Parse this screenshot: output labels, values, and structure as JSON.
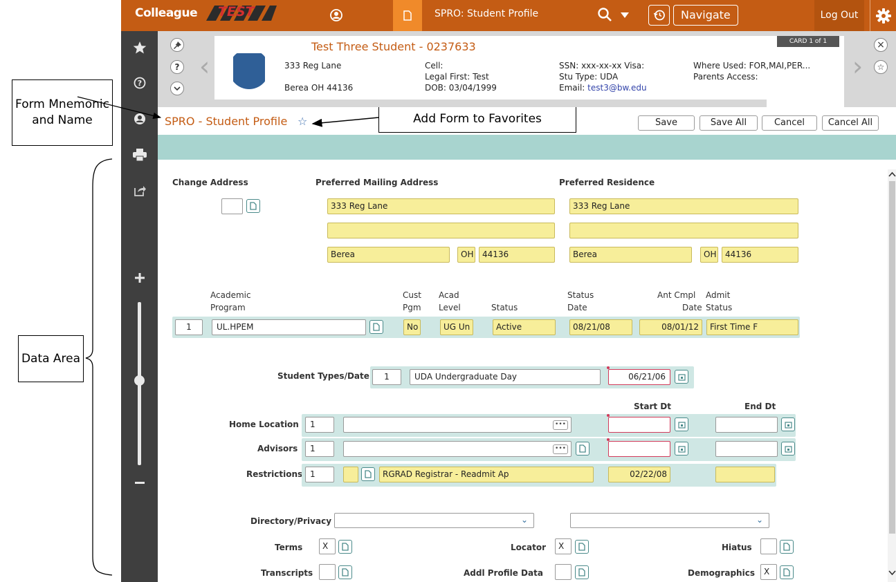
{
  "callouts": {
    "form_label": "Form Mnemonic and Name",
    "favorites_label": "Add Form to Favorites",
    "data_area_label": "Data Area"
  },
  "topbar": {
    "brand": "Colleague",
    "env": "TEST",
    "form_tab": "SPRO: Student Profile",
    "navigate": "Navigate",
    "logout": "Log Out"
  },
  "card": {
    "count": "CARD 1 of 1",
    "name": "Test Three Student  -  0237633",
    "addr1": "333 Reg Lane",
    "addr2": "Berea OH 44136",
    "cell": "Cell:",
    "legal_first": "Legal First: Test",
    "dob": "DOB: 03/04/1999",
    "ssn": "SSN: xxx-xx-xx Visa:",
    "stu_type": "Stu Type: UDA",
    "email_label": "Email: ",
    "email": "test3@bw.edu",
    "where_used": "Where Used: FOR,MAI,PER...",
    "parents": "Parents Access:"
  },
  "form": {
    "title": "SPRO - Student Profile",
    "save": "Save",
    "save_all": "Save All",
    "cancel": "Cancel",
    "cancel_all": "Cancel All"
  },
  "address": {
    "change_label": "Change Address",
    "mailing_label": "Preferred Mailing Address",
    "residence_label": "Preferred Residence",
    "mailing": {
      "line1": "333 Reg Lane",
      "line2": "",
      "city": "Berea",
      "state": "OH",
      "zip": "44136"
    },
    "residence": {
      "line1": "333 Reg Lane",
      "line2": "",
      "city": "Berea",
      "state": "OH",
      "zip": "44136"
    }
  },
  "program": {
    "headers": {
      "academic": "Academic",
      "program": "Program",
      "cust": "Cust",
      "pgm": "Pgm",
      "acad": "Acad",
      "level": "Level",
      "status": "Status",
      "status2": "Status",
      "date": "Date",
      "ant_cmpl": "Ant Cmpl",
      "ant_date": "Date",
      "admit": "Admit",
      "admit_status": "Status"
    },
    "row": {
      "num": "1",
      "program": "UL.HPEM",
      "cust": "No",
      "level": "UG Un",
      "status": "Active",
      "status_date": "08/21/08",
      "ant_date": "08/01/12",
      "admit": "First Time F"
    }
  },
  "student_types": {
    "label": "Student Types/Date",
    "num": "1",
    "value": "UDA Undergraduate Day",
    "date": "06/21/06"
  },
  "dates_header": {
    "start": "Start Dt",
    "end": "End Dt"
  },
  "home_location": {
    "label": "Home Location",
    "num": "1"
  },
  "advisors": {
    "label": "Advisors",
    "num": "1"
  },
  "restrictions": {
    "label": "Restrictions",
    "num": "1",
    "value": "RGRAD Registrar - Readmit Ap",
    "date": "02/22/08"
  },
  "flags": {
    "privacy_label": "Directory/Privacy",
    "terms_label": "Terms",
    "terms_val": "X",
    "locator_label": "Locator",
    "locator_val": "X",
    "hiatus_label": "Hiatus",
    "hiatus_val": "",
    "transcripts_label": "Transcripts",
    "transcripts_val": "",
    "addl_label": "Addl Profile Data",
    "addl_val": "",
    "demo_label": "Demographics",
    "demo_val": "X"
  },
  "icons": [
    "star-icon",
    "help-icon",
    "person-icon",
    "print-icon",
    "export-icon",
    "zoom-in-icon",
    "zoom-out-icon",
    "pin-icon",
    "gear-icon",
    "search-icon",
    "history-icon",
    "document-icon",
    "calendar-icon"
  ]
}
